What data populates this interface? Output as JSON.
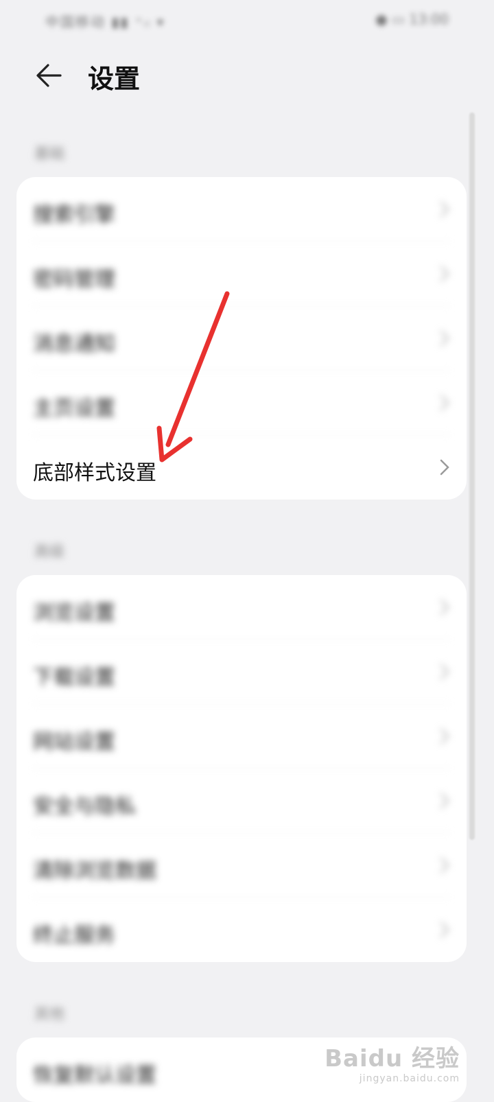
{
  "status_bar": {
    "left_text": "中国移动 ▮▮ ⁺ᵢₗ ▾",
    "right_text": "● ▭ 13:00"
  },
  "header": {
    "title": "设置",
    "back_icon": "arrow-left-icon"
  },
  "sections": [
    {
      "label": "基础",
      "items": [
        {
          "label": "搜索引擎"
        },
        {
          "label": "密码管理"
        },
        {
          "label": "消息通知"
        },
        {
          "label": "主页设置"
        },
        {
          "label": "底部样式设置"
        }
      ]
    },
    {
      "label": "高级",
      "items": [
        {
          "label": "浏览设置"
        },
        {
          "label": "下载设置"
        },
        {
          "label": "网站设置"
        },
        {
          "label": "安全与隐私"
        },
        {
          "label": "清除浏览数据"
        },
        {
          "label": "终止服务"
        }
      ]
    },
    {
      "label": "其他",
      "items": [
        {
          "label": "恢复默认设置"
        }
      ]
    }
  ],
  "annotation": {
    "arrow_color": "#e8312f"
  },
  "watermark": {
    "logo": "Baidu 经验",
    "sub": "jingyan.baidu.com"
  }
}
